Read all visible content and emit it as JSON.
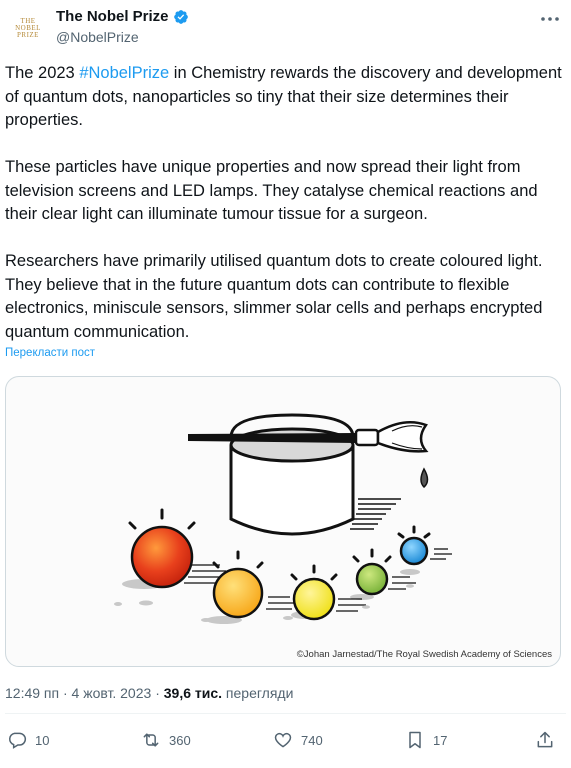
{
  "author": {
    "avatar_lines": [
      "THE",
      "NOBEL",
      "PRIZE"
    ],
    "display_name": "The Nobel Prize",
    "handle": "@NobelPrize"
  },
  "tweet": {
    "p1_before": "The 2023 ",
    "hashtag": "#NobelPrize",
    "p1_after": " in Chemistry rewards the discovery and development of quantum dots, nanoparticles so tiny that their size determines their properties.",
    "p2": "These particles have unique properties and now spread their light from television screens and LED lamps. They catalyse chemical reactions and their clear light can illuminate tumour tissue for a surgeon.",
    "p3": "Researchers have primarily utilised quantum dots to create coloured light. They believe that in the future quantum dots can contribute to flexible electronics, miniscule sensors, slimmer solar cells and perhaps encrypted quantum communication.",
    "translate_label": "Перекласти пост"
  },
  "media": {
    "credit": "©Johan Jarnestad/The Royal Swedish Academy of Sciences",
    "colors": {
      "red": "#e8401c",
      "orange": "#f7a81b",
      "yellow": "#f3e21c",
      "green": "#8cc63f",
      "blue": "#1c9be0"
    }
  },
  "meta": {
    "time": "12:49 пп",
    "separator": "·",
    "date": "4 жовт. 2023",
    "views_count": "39,6 тис.",
    "views_label": "перегляди"
  },
  "actions": {
    "replies": "10",
    "reposts": "360",
    "likes": "740",
    "bookmarks": "17"
  },
  "colors": {
    "accent": "#1d9bf0",
    "text": "#0f1419",
    "muted": "#536471"
  }
}
